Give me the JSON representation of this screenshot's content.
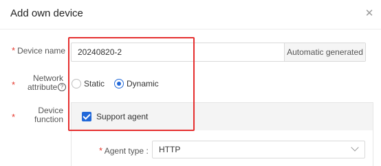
{
  "dialog": {
    "title": "Add own device",
    "close_glyph": "✕"
  },
  "form": {
    "required_mark": "*",
    "device_name": {
      "label": "Device name",
      "colon": ":",
      "value": "20240820-2",
      "auto_button": "Automatic generated"
    },
    "network_attribute": {
      "label_line1": "Network",
      "label_line2": "attribute",
      "help_glyph": "?",
      "options": [
        {
          "label": "Static",
          "selected": false
        },
        {
          "label": "Dynamic",
          "selected": true
        }
      ]
    },
    "device_function": {
      "label_line1": "Device",
      "label_line2": "function",
      "support_agent": {
        "label": "Support agent",
        "checked": true
      },
      "agent_type": {
        "label": "Agent type",
        "colon": ":",
        "value": "HTTP"
      }
    }
  },
  "colors": {
    "accent": "#2168d9",
    "required": "#e5382d",
    "highlight_box": "#e52d2d"
  },
  "icons": [
    "close-icon",
    "help-icon",
    "checkbox-checked-icon",
    "chevron-down-icon"
  ]
}
